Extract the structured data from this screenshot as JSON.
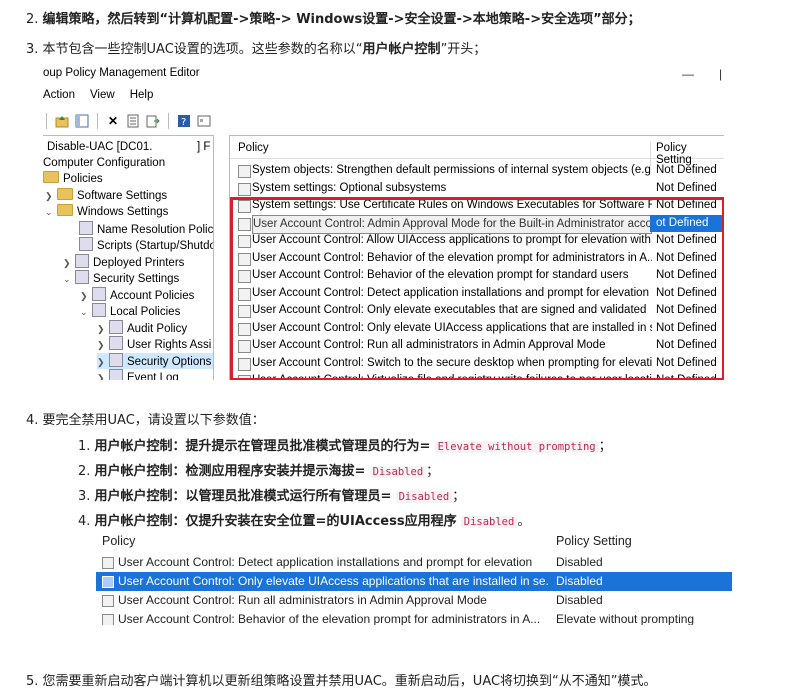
{
  "steps": {
    "s2": {
      "num": "2.",
      "text": "编辑策略，然后转到“计算机配置->策略-> Windows设置->安全设置->本地策略->安全选项”部分；"
    },
    "s3": {
      "num": "3.",
      "text_a": "本节包含一些控制UAC设置的选项。这些参数的名称以“",
      "bold": "用户帐户控制",
      "text_b": "”开头；"
    },
    "s4": {
      "num": "4.",
      "text": "要完全禁用UAC，请设置以下参数值："
    },
    "s5": {
      "num": "5.",
      "text": "您需要重新启动客户端计算机以更新组策略设置并禁用UAC。重新启动后，UAC将切换到“从不通知”模式。"
    }
  },
  "substeps": [
    {
      "num": "1.",
      "label": "用户帐户控制：提升提示在管理员批准模式管理员的行为=",
      "code": "Elevate without prompting",
      "end": "；"
    },
    {
      "num": "2.",
      "label": "用户帐户控制：检测应用程序安装并提示海拔=",
      "code": "Disabled",
      "end": "；"
    },
    {
      "num": "3.",
      "label": "用户帐户控制：以管理员批准模式运行所有管理员=",
      "code": "Disabled",
      "end": "；"
    },
    {
      "num": "4.",
      "label": "用户帐户控制：仅提升安装在安全位置=的UIAccess应用程序",
      "code": "Disabled",
      "end": "。"
    }
  ],
  "editor": {
    "title": "oup Policy Management Editor",
    "menu": [
      "Action",
      "View",
      "Help"
    ],
    "tree": [
      {
        "label": "Disable-UAC [DC01.",
        "suffix": "] F"
      },
      {
        "label": "Computer Configuration"
      },
      {
        "label": "Policies"
      },
      {
        "label": "Software Settings"
      },
      {
        "label": "Windows Settings"
      },
      {
        "label": "Name Resolution Policy"
      },
      {
        "label": "Scripts (Startup/Shutdo"
      },
      {
        "label": "Deployed Printers"
      },
      {
        "label": "Security Settings"
      },
      {
        "label": "Account Policies"
      },
      {
        "label": "Local Policies"
      },
      {
        "label": "Audit Policy"
      },
      {
        "label": "User Rights Assi"
      },
      {
        "label": "Security Options"
      },
      {
        "label": "Event Log"
      }
    ],
    "col_policy": "Policy",
    "col_setting": "Policy Setting",
    "rows": [
      {
        "name": "System objects: Strengthen default permissions of internal system objects (e.g. ...",
        "setting": "Not Defined"
      },
      {
        "name": "System settings: Optional subsystems",
        "setting": "Not Defined"
      },
      {
        "name": "System settings: Use Certificate Rules on Windows Executables for Software Rest...",
        "setting": "Not Defined"
      },
      {
        "name": "User Account Control: Admin Approval Mode for the Built-in Administrator account",
        "setting": "ot Defined"
      },
      {
        "name": "User Account Control: Allow UIAccess applications to prompt for elevation with...",
        "setting": "Not Defined"
      },
      {
        "name": "User Account Control: Behavior of the elevation prompt for administrators in A...",
        "setting": "Not Defined"
      },
      {
        "name": "User Account Control: Behavior of the elevation prompt for standard users",
        "setting": "Not Defined"
      },
      {
        "name": "User Account Control: Detect application installations and prompt for elevation",
        "setting": "Not Defined"
      },
      {
        "name": "User Account Control: Only elevate executables that are signed and validated",
        "setting": "Not Defined"
      },
      {
        "name": "User Account Control: Only elevate UIAccess applications that are installed in se...",
        "setting": "Not Defined"
      },
      {
        "name": "User Account Control: Run all administrators in Admin Approval Mode",
        "setting": "Not Defined"
      },
      {
        "name": "User Account Control: Switch to the secure desktop when prompting for elevati...",
        "setting": "Not Defined"
      },
      {
        "name": "User Account Control: Virtualize file and registry write failures to per-user locati...",
        "setting": "Not Defined"
      }
    ]
  },
  "policy_table": {
    "col_policy": "Policy",
    "col_setting": "Policy Setting",
    "rows": [
      {
        "name": "User Account Control: Detect application installations and prompt for elevation",
        "setting": "Disabled"
      },
      {
        "name": "User Account Control: Only elevate UIAccess applications that are installed in se...",
        "setting": "Disabled"
      },
      {
        "name": "User Account Control: Run all administrators in Admin Approval Mode",
        "setting": "Disabled"
      },
      {
        "name": "User Account Control: Behavior of the elevation prompt for administrators in A...",
        "setting": "Elevate without prompting"
      }
    ]
  },
  "colors": {
    "highlight": "#1a73d9",
    "red_box": "#d9202a",
    "code_text": "#c7254e"
  }
}
